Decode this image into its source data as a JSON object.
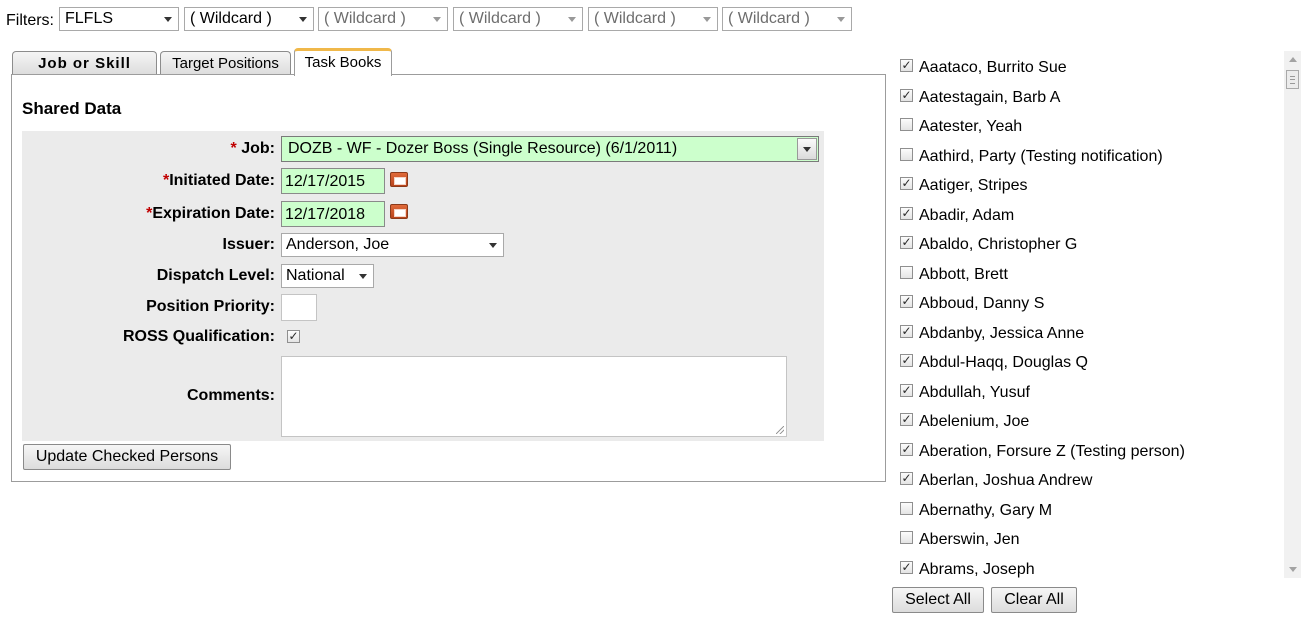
{
  "filters": {
    "label": "Filters:",
    "selects": [
      "FLFLS",
      "( Wildcard )",
      "( Wildcard )",
      "( Wildcard )",
      "( Wildcard )",
      "( Wildcard )"
    ]
  },
  "tabs": [
    {
      "label": "Job or Skill"
    },
    {
      "label": "Target Positions"
    },
    {
      "label": "Task Books",
      "active": true
    }
  ],
  "form": {
    "section_title": "Shared Data",
    "required_mark": "*",
    "job": {
      "label": "Job:",
      "value": "DOZB - WF - Dozer Boss (Single Resource) (6/1/2011)"
    },
    "initiated_date": {
      "label": "Initiated Date:",
      "value": "12/17/2015"
    },
    "expiration_date": {
      "label": "Expiration Date:",
      "value": "12/17/2018"
    },
    "issuer": {
      "label": "Issuer:",
      "value": "Anderson, Joe"
    },
    "dispatch_level": {
      "label": "Dispatch Level:",
      "value": "National"
    },
    "position_priority": {
      "label": "Position Priority:",
      "value": ""
    },
    "ross_qualification": {
      "label": "ROSS Qualification:",
      "checked": true
    },
    "comments": {
      "label": "Comments:",
      "value": ""
    },
    "update_button": "Update Checked Persons"
  },
  "people": [
    {
      "name": "Aaataco, Burrito Sue",
      "checked": true
    },
    {
      "name": "Aatestagain, Barb A",
      "checked": true
    },
    {
      "name": "Aatester, Yeah",
      "checked": false
    },
    {
      "name": "Aathird, Party (Testing notification)",
      "checked": false
    },
    {
      "name": "Aatiger, Stripes",
      "checked": true
    },
    {
      "name": "Abadir, Adam",
      "checked": true
    },
    {
      "name": "Abaldo, Christopher G",
      "checked": true
    },
    {
      "name": "Abbott, Brett",
      "checked": false
    },
    {
      "name": "Abboud, Danny S",
      "checked": true
    },
    {
      "name": "Abdanby, Jessica Anne",
      "checked": true
    },
    {
      "name": "Abdul-Haqq, Douglas Q",
      "checked": true
    },
    {
      "name": "Abdullah, Yusuf",
      "checked": true
    },
    {
      "name": "Abelenium, Joe",
      "checked": true
    },
    {
      "name": "Aberation, Forsure Z (Testing person)",
      "checked": true
    },
    {
      "name": "Aberlan, Joshua Andrew",
      "checked": true
    },
    {
      "name": "Abernathy, Gary M",
      "checked": false
    },
    {
      "name": "Aberswin, Jen",
      "checked": false
    },
    {
      "name": "Abrams, Joseph",
      "checked": true
    }
  ],
  "list_buttons": {
    "select_all": "Select All",
    "clear_all": "Clear All"
  },
  "colors": {
    "required_field_bg": "#ccffcc",
    "active_tab_accent": "#f0b84a",
    "form_bg": "#ebebeb"
  }
}
